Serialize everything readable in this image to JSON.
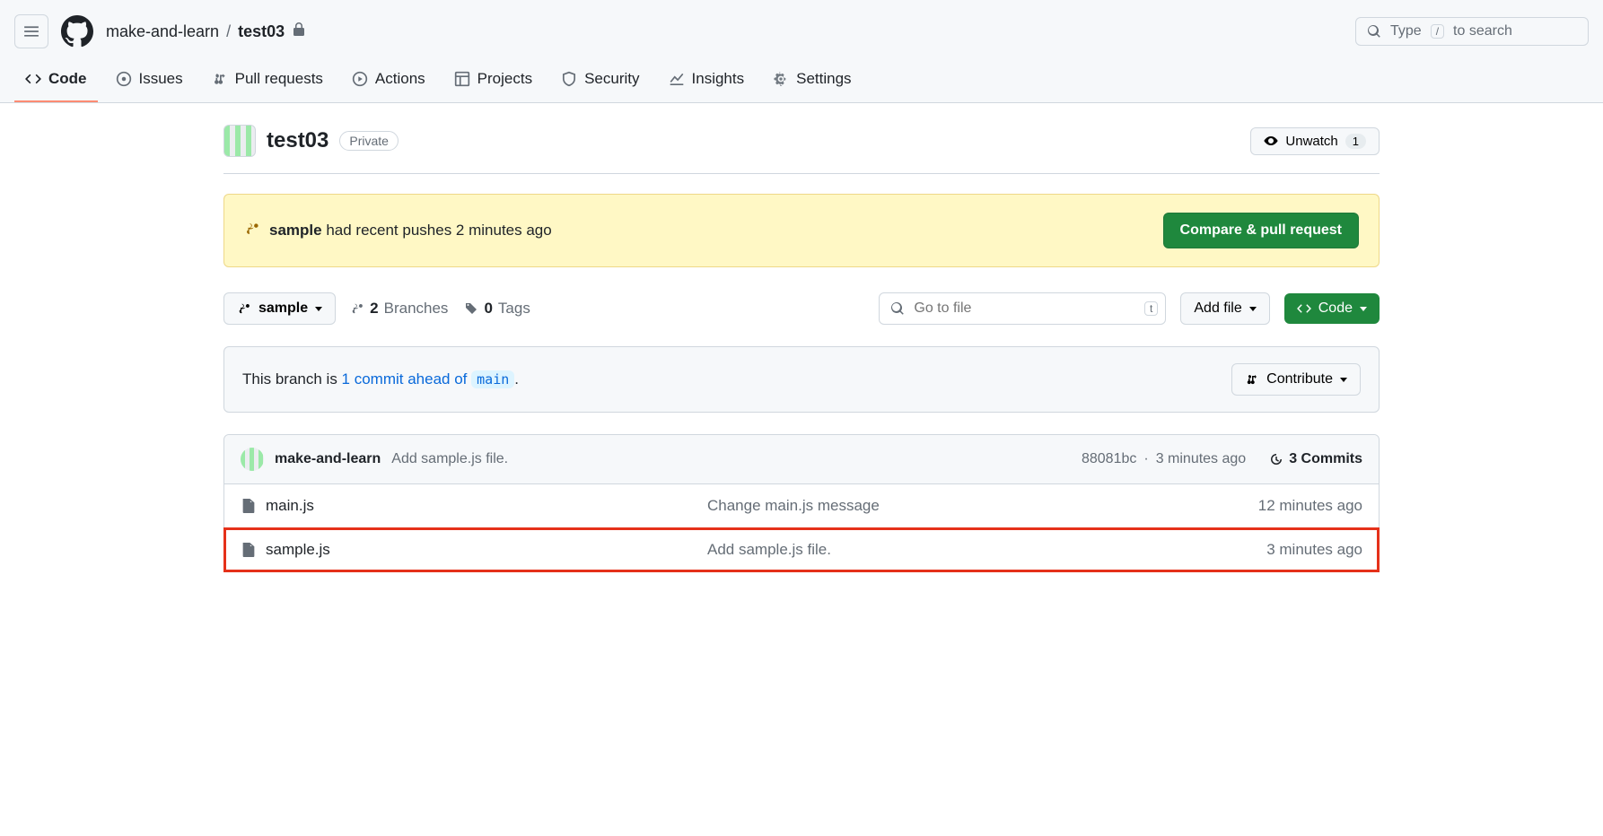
{
  "header": {
    "owner": "make-and-learn",
    "repo": "test03",
    "search_placeholder": "Type",
    "search_tail": "to search",
    "search_key": "/"
  },
  "nav": {
    "code": "Code",
    "issues": "Issues",
    "pulls": "Pull requests",
    "actions": "Actions",
    "projects": "Projects",
    "security": "Security",
    "insights": "Insights",
    "settings": "Settings"
  },
  "repo": {
    "name": "test03",
    "visibility": "Private",
    "unwatch_label": "Unwatch",
    "watch_count": "1"
  },
  "flash": {
    "branch": "sample",
    "text_tail": " had recent pushes 2 minutes ago",
    "button": "Compare & pull request"
  },
  "toolbar": {
    "branch": "sample",
    "branches_count": "2",
    "branches_label": "Branches",
    "tags_count": "0",
    "tags_label": "Tags",
    "go_to_file": "Go to file",
    "go_key": "t",
    "add_file": "Add file",
    "code_btn": "Code"
  },
  "ahead": {
    "prefix": "This branch is ",
    "link": "1 commit ahead of",
    "base": "main",
    "suffix": ".",
    "contribute": "Contribute"
  },
  "commit": {
    "author": "make-and-learn",
    "message": "Add sample.js file.",
    "sha": "88081bc",
    "time": "3 minutes ago",
    "commits_count": "3 Commits"
  },
  "files": [
    {
      "name": "main.js",
      "message": "Change main.js message",
      "time": "12 minutes ago",
      "highlight": false
    },
    {
      "name": "sample.js",
      "message": "Add sample.js file.",
      "time": "3 minutes ago",
      "highlight": true
    }
  ]
}
